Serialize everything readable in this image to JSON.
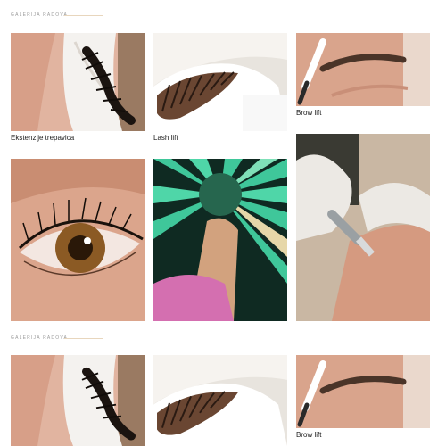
{
  "gallery_heading": "GALERIJA RADOVA",
  "captions": {
    "eyelash_extensions": "Ekstenzije trepavica",
    "lash_lift": "Lash lift",
    "brow_lift": "Brow lift"
  },
  "colors": {
    "accent_rule": "#e8d6bd",
    "skin": "#dba58c",
    "lash": "#1b1410",
    "glove": "#ece9e4",
    "solarium_green": "#3fc79a"
  }
}
